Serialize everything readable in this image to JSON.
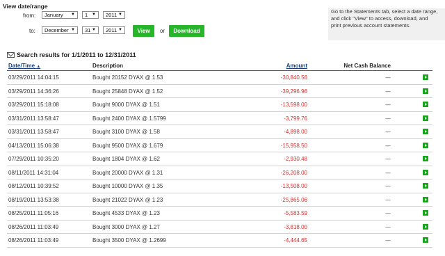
{
  "range": {
    "title": "View date/range",
    "from_label": "from:",
    "to_label": "to:",
    "from": {
      "month": "January",
      "day": "1",
      "year": "2011"
    },
    "to": {
      "month": "December",
      "day": "31",
      "year": "2011"
    },
    "view_label": "View",
    "or_label": "or",
    "download_label": "Download"
  },
  "help_text": "Go to the Statements tab, select a date range, and click \"View\" to access, download, and print previous account statements.",
  "results_title": "Search results for 1/1/2011 to 12/31/2011",
  "columns": {
    "date": "Date/Time",
    "description": "Description",
    "amount": "Amount",
    "net_cash": "Net Cash Balance"
  },
  "rows": [
    {
      "date": "03/29/2011  14:04:15",
      "desc": "Bought 20152 DYAX @ 1.53",
      "amount": "-30,840.56",
      "ncb": "---"
    },
    {
      "date": "03/29/2011  14:36:26",
      "desc": "Bought 25848 DYAX @ 1.52",
      "amount": "-39,296.96",
      "ncb": "---"
    },
    {
      "date": "03/29/2011  15:18:08",
      "desc": "Bought 9000 DYAX @ 1.51",
      "amount": "-13,598.00",
      "ncb": "---"
    },
    {
      "date": "03/31/2011  13:58:47",
      "desc": "Bought 2400 DYAX @ 1.5799",
      "amount": "-3,799.76",
      "ncb": "---"
    },
    {
      "date": "03/31/2011  13:58:47",
      "desc": "Bought 3100 DYAX @ 1.58",
      "amount": "-4,898.00",
      "ncb": "---"
    },
    {
      "date": "04/13/2011  15:06:38",
      "desc": "Bought 9500 DYAX @ 1.679",
      "amount": "-15,958.50",
      "ncb": "---"
    },
    {
      "date": "07/29/2011  10:35:20",
      "desc": "Bought 1804 DYAX @ 1.62",
      "amount": "-2,930.48",
      "ncb": "---"
    },
    {
      "date": "08/11/2011  14:31:04",
      "desc": "Bought 20000 DYAX @ 1.31",
      "amount": "-26,208.00",
      "ncb": "---"
    },
    {
      "date": "08/12/2011  10:39:52",
      "desc": "Bought 10000 DYAX @ 1.35",
      "amount": "-13,508.00",
      "ncb": "---"
    },
    {
      "date": "08/19/2011  13:53:38",
      "desc": "Bought 21022 DYAX @ 1.23",
      "amount": "-25,865.06",
      "ncb": "---"
    },
    {
      "date": "08/25/2011  11:05:16",
      "desc": "Bought 4533 DYAX @ 1.23",
      "amount": "-5,583.59",
      "ncb": "---"
    },
    {
      "date": "08/26/2011  11:03:49",
      "desc": "Bought 3000 DYAX @ 1.27",
      "amount": "-3,818.00",
      "ncb": "---"
    },
    {
      "date": "08/26/2011  11:03:49",
      "desc": "Bought 3500 DYAX @ 1.2699",
      "amount": "-4,444.65",
      "ncb": "---"
    }
  ],
  "colors": {
    "accent_green": "#27b629",
    "negative_red": "#d03030",
    "link_blue": "#1a3f80"
  }
}
